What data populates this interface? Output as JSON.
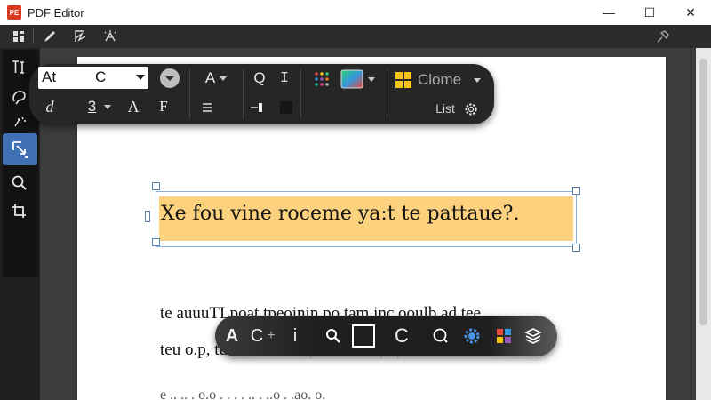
{
  "window": {
    "title": "PDF Editor",
    "logo_text": "PE",
    "minimize": "—",
    "maximize": "☐",
    "close": "✕"
  },
  "toolbar": {
    "icons": [
      "layout-icon",
      "pen-icon",
      "signature-icon",
      "magic-icon",
      "pin-icon"
    ]
  },
  "leftrail": {
    "tools": [
      "text-cursor-tool",
      "lasso-tool",
      "transform-tool",
      "zoom-tool",
      "crop-tool"
    ],
    "active_tool": "transform-tool"
  },
  "format_bar": {
    "font_name": "At",
    "font_style": "C",
    "text_a": "A",
    "q_label": "Q",
    "i_label": "I",
    "swatch_label": "Clome",
    "list_label": "List",
    "italic_d": "d",
    "underline_3": "3",
    "serif_a": "A",
    "serif_f": "F",
    "swatch_color": "#f5c518",
    "accent_color": "#3f6fb5"
  },
  "document": {
    "highlight_text": "Xe fou vine roceme ya:t te pattaue?.",
    "highlight_color": "#fcd27f",
    "line1": "te auuuTLpoat tpeoinin po tam inc ooulb ad tee",
    "line2": "teu o.p,  tuo . fo ra.o .. ,be ota . o., . ,",
    "line3": "e .. .. . o.o . . . . .. . ..o . .ao. o."
  },
  "bottom_bar": {
    "labels": [
      "A",
      "C",
      "+",
      "i",
      "C"
    ]
  }
}
